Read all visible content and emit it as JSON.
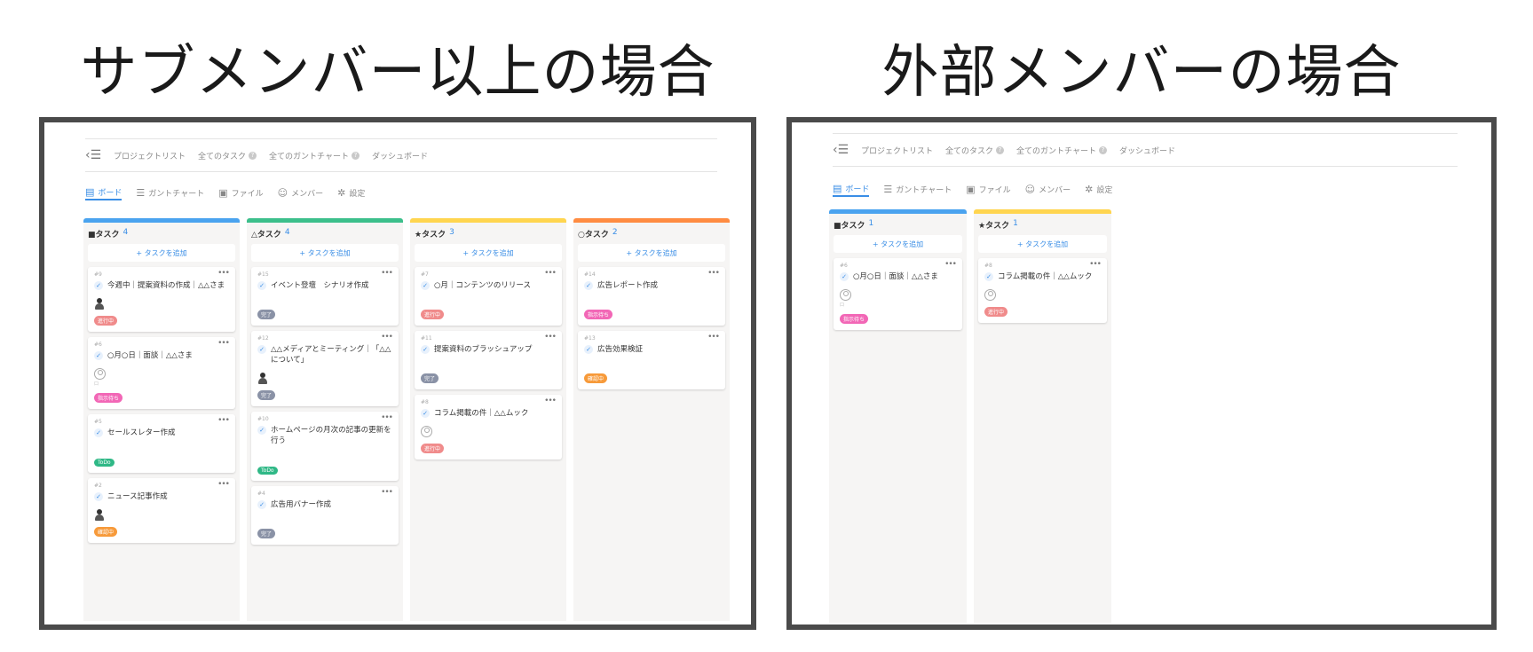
{
  "headings": {
    "left": "サブメンバー以上の場合",
    "right": "外部メンバーの場合"
  },
  "nav": {
    "back_icon": "collapse-menu-icon",
    "items": [
      "プロジェクトリスト",
      "全てのタスク",
      "全てのガントチャート",
      "ダッシュボード"
    ],
    "help_icon": "?"
  },
  "tabs": {
    "board": "ボード",
    "gantt": "ガントチャート",
    "file": "ファイル",
    "member": "メンバー",
    "settings": "設定"
  },
  "common": {
    "add_task": "+ タスクを追加",
    "more": "•••",
    "check": "✓"
  },
  "colors": {
    "blue": "#4aa3ef",
    "green": "#3cbf8b",
    "yellow": "#ffd54f",
    "orange": "#ff8c42",
    "badge_progress": "#f08b8b",
    "badge_done": "#8a92a6",
    "badge_waiting": "#f267b6",
    "badge_todo": "#2fb886",
    "badge_confirm": "#f79a3a"
  },
  "left": {
    "columns": [
      {
        "name": "■タスク",
        "count": "4",
        "cards": [
          {
            "num": "#9",
            "title": "今週中｜提案資料の作成｜△△さま",
            "avatar": "person",
            "badge": "進行中",
            "badge_color": "#f08b8b"
          },
          {
            "num": "#6",
            "title": "○月○日｜面談｜△△さま",
            "avatar": "ghost",
            "sub": "口",
            "badge": "指示待ち",
            "badge_color": "#f267b6"
          },
          {
            "num": "#5",
            "title": "セールスレター作成",
            "avatar": "",
            "badge": "ToDo",
            "badge_color": "#2fb886"
          },
          {
            "num": "#2",
            "title": "ニュース記事作成",
            "avatar": "person",
            "badge": "確認中",
            "badge_color": "#f79a3a"
          }
        ]
      },
      {
        "name": "△タスク",
        "count": "4",
        "cards": [
          {
            "num": "#15",
            "title": "イベント登壇　シナリオ作成",
            "avatar": "",
            "badge": "完了",
            "badge_color": "#8a92a6"
          },
          {
            "num": "#12",
            "title": "△△メディアとミーティング｜「△△について」",
            "avatar": "person",
            "badge": "完了",
            "badge_color": "#8a92a6"
          },
          {
            "num": "#10",
            "title": "ホームページの月次の記事の更新を行う",
            "avatar": "",
            "badge": "ToDo",
            "badge_color": "#2fb886"
          },
          {
            "num": "#4",
            "title": "広告用バナー作成",
            "avatar": "",
            "badge": "完了",
            "badge_color": "#8a92a6"
          }
        ]
      },
      {
        "name": "★タスク",
        "count": "3",
        "cards": [
          {
            "num": "#7",
            "title": "○月｜コンテンツのリリース",
            "avatar": "",
            "badge": "進行中",
            "badge_color": "#f08b8b"
          },
          {
            "num": "#11",
            "title": "提案資料のブラッシュアップ",
            "avatar": "",
            "badge": "完了",
            "badge_color": "#8a92a6"
          },
          {
            "num": "#8",
            "title": "コラム掲載の件｜△△ムック",
            "avatar": "ghost",
            "badge": "進行中",
            "badge_color": "#f08b8b"
          }
        ]
      },
      {
        "name": "○タスク",
        "count": "2",
        "cards": [
          {
            "num": "#14",
            "title": "広告レポート作成",
            "avatar": "",
            "badge": "指示待ち",
            "badge_color": "#f267b6"
          },
          {
            "num": "#13",
            "title": "広告効果検証",
            "avatar": "",
            "badge": "確認中",
            "badge_color": "#f79a3a"
          }
        ]
      }
    ]
  },
  "right": {
    "columns": [
      {
        "name": "■タスク",
        "count": "1",
        "cards": [
          {
            "num": "#6",
            "title": "○月○日｜面談｜△△さま",
            "avatar": "ghost",
            "sub": "口",
            "badge": "指示待ち",
            "badge_color": "#f267b6"
          }
        ]
      },
      {
        "name": "★タスク",
        "count": "1",
        "cards": [
          {
            "num": "#8",
            "title": "コラム掲載の件｜△△ムック",
            "avatar": "ghost",
            "badge": "進行中",
            "badge_color": "#f08b8b"
          }
        ]
      }
    ]
  }
}
